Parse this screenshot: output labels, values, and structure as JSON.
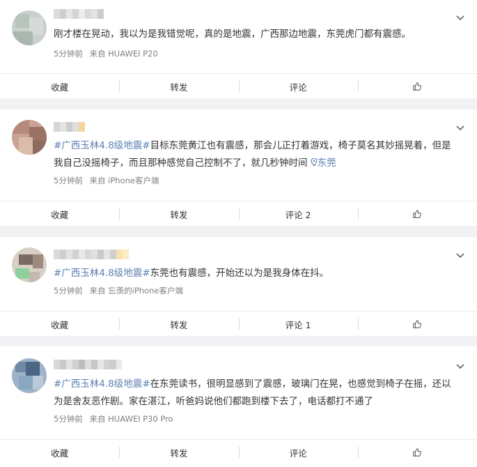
{
  "posts": [
    {
      "text": "刚才楼在晃动，我以为是我错觉呢，真的是地震，广西那边地震，东莞虎门都有震感。",
      "hashtag": "",
      "location": "",
      "time": "5分钟前",
      "source": "来自 HUAWEI P20",
      "actions": {
        "favorite": "收藏",
        "repost": "转发",
        "comment": "评论"
      }
    },
    {
      "hashtag": "#广西玉林4.8级地震#",
      "text": "目标东莞黄江也有震感，那会儿正打着游戏，椅子莫名其妙摇晃着，但是我自己没摇椅子，而且那种感觉自己控制不了，就几秒钟时间",
      "location": "东莞",
      "time": "5分钟前",
      "source": "来自 iPhone客户端",
      "actions": {
        "favorite": "收藏",
        "repost": "转发",
        "comment": "评论 2"
      }
    },
    {
      "hashtag": "#广西玉林4.8级地震#",
      "text": "东莞也有震感，开始还以为是我身体在抖。",
      "location": "",
      "time": "5分钟前",
      "source": "来自 忘羡的iPhone客户端",
      "actions": {
        "favorite": "收藏",
        "repost": "转发",
        "comment": "评论 1"
      }
    },
    {
      "hashtag": "#广西玉林4.8级地震#",
      "text": "在东莞读书，很明显感到了震感，玻璃门在晃，也感觉到椅子在摇，还以为是舍友恶作剧。家在湛江，听爸妈说他们都跑到楼下去了，电话都打不通了",
      "location": "",
      "time": "5分钟前",
      "source": "来自 HUAWEI P30 Pro",
      "actions": {
        "favorite": "收藏",
        "repost": "转发",
        "comment": "评论"
      }
    }
  ],
  "icons": {
    "more": "chevron-down-icon",
    "like": "thumbs-up-icon",
    "location": "location-pin-icon"
  },
  "colors": {
    "link": "#5c7fb3",
    "meta": "#808080",
    "background": "#f2f2f5"
  }
}
